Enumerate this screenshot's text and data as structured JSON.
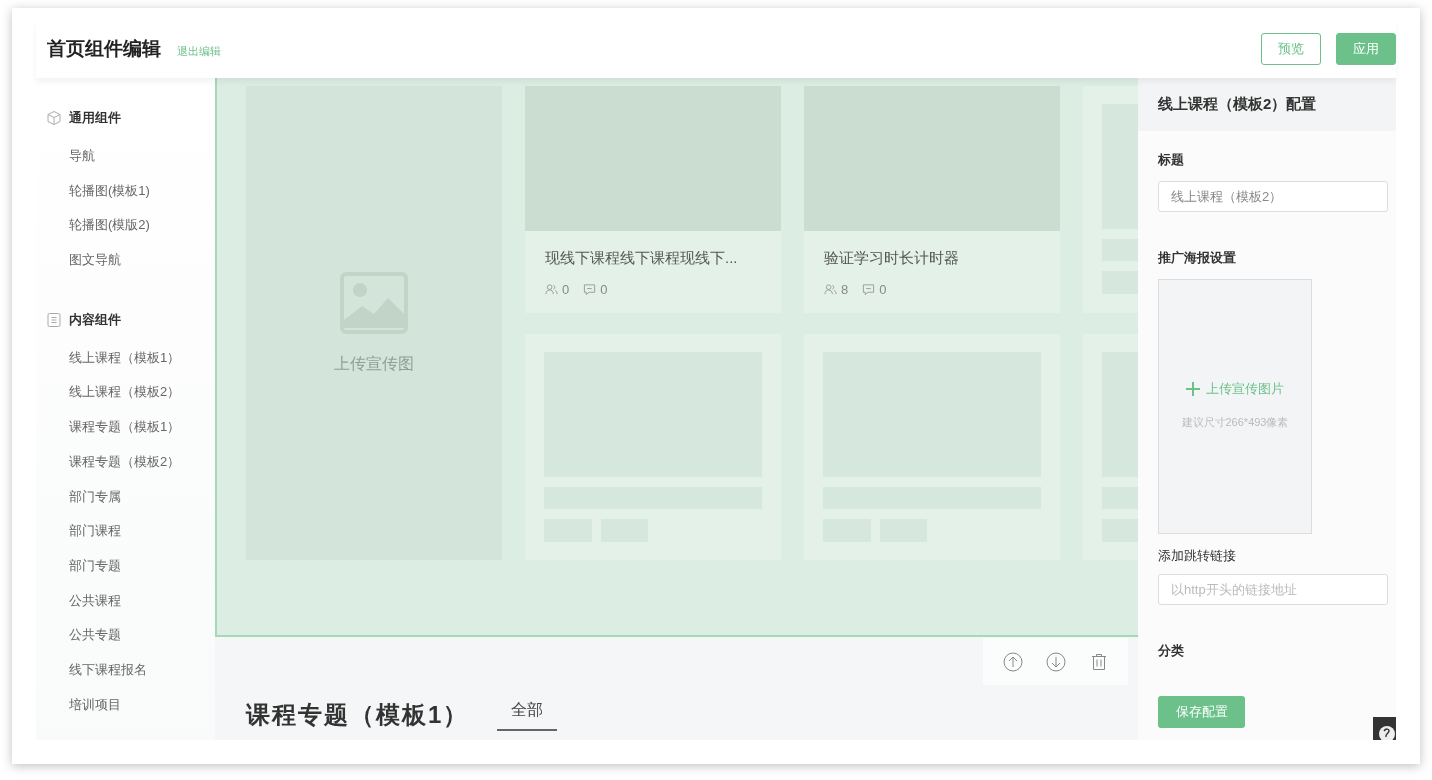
{
  "header": {
    "title": "首页组件编辑",
    "exit_link": "退出编辑",
    "buttons": [
      {
        "label": "预览",
        "kind": "outline"
      },
      {
        "label": "应用",
        "kind": "primary"
      }
    ]
  },
  "sidebar": {
    "groups": [
      {
        "title": "通用组件",
        "kind": "cube",
        "items": [
          "导航",
          "轮播图(模板1)",
          "轮播图(模版2)",
          "图文导航"
        ]
      },
      {
        "title": "内容组件",
        "kind": "doc",
        "items": [
          "线上课程（模板1）",
          "线上课程（模板2）",
          "课程专题（模板1）",
          "课程专题（模板2）",
          "部门专属",
          "部门课程",
          "部门专题",
          "公共课程",
          "公共专题",
          "线下课程报名",
          "培训项目"
        ]
      }
    ]
  },
  "canvas": {
    "poster": {
      "label": "上传宣传图"
    },
    "cards": [
      {
        "kind": "course",
        "title": "现线下课程线下课程现线下...",
        "learners": "0",
        "comments": "0"
      },
      {
        "kind": "course",
        "title": "验证学习时长计时器",
        "learners": "8",
        "comments": "0"
      },
      {
        "kind": "skeleton"
      },
      {
        "kind": "skeleton"
      },
      {
        "kind": "skeleton"
      },
      {
        "kind": "skeleton"
      }
    ]
  },
  "next_section": {
    "title": "课程专题（模板1）",
    "tabs": [
      {
        "label": "全部",
        "selected": true
      }
    ]
  },
  "config": {
    "title": "线上课程（模板2）配置",
    "title_label": "标题",
    "title_value": "线上课程（模板2）",
    "poster_label": "推广海报设置",
    "upload_label": "上传宣传图片",
    "upload_hint": "建议尺寸266*493像素",
    "link_label": "添加跳转链接",
    "link_placeholder": "以http开头的链接地址",
    "category_label": "分类",
    "save_button": "保存配置"
  }
}
